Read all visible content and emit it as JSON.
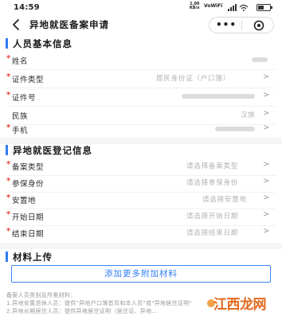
{
  "status_bar": {
    "time": "14:59",
    "net_speed": "1.00\nKB/s",
    "vowifi": "VoWiFi",
    "battery_level": 0.5
  },
  "header": {
    "title": "异地就医备案申请",
    "back_icon": "chevron-left-icon",
    "more_icon": "more-dots-icon",
    "close_icon": "target-close-icon"
  },
  "sections": {
    "basic": {
      "title": "人员基本信息"
    },
    "register": {
      "title": "异地就医登记信息"
    },
    "materials": {
      "title": "材料上传"
    }
  },
  "basic_rows": [
    {
      "label": "姓名",
      "value": "",
      "required": "*",
      "chevron": ""
    },
    {
      "label": "证件类型",
      "value": "居民身份证（户口簿）",
      "required": "*",
      "chevron": ">"
    },
    {
      "label": "证件号",
      "value": "",
      "required": "*",
      "chevron": ">"
    },
    {
      "label": "民族",
      "value": "汉族",
      "required": "",
      "chevron": ">"
    },
    {
      "label": "手机",
      "value": "",
      "required": "*",
      "chevron": ">"
    }
  ],
  "register_rows": [
    {
      "label": "备案类型",
      "value": "请选择备案类型",
      "required": "*",
      "chevron": ">"
    },
    {
      "label": "参保身份",
      "value": "请选择参保身份",
      "required": "*",
      "chevron": ">"
    },
    {
      "label": "安置地",
      "value": "请选择安置地",
      "required": "*",
      "chevron": ">"
    },
    {
      "label": "开始日期",
      "value": "请选择开始日期",
      "required": "*",
      "chevron": ">"
    },
    {
      "label": "结束日期",
      "value": "请选择结束日期",
      "required": "*",
      "chevron": ">"
    }
  ],
  "materials": {
    "add_button": "添加更多附加材料",
    "notes": [
      "备案人员类别及所需材料：",
      "1.异地安置退休人员：提供\"异地户口簿首页和本人页\"或\"异地居住证明\"",
      "2.异地长期居住人员：提供异地居住证明（居住证、异地…"
    ]
  },
  "watermark": {
    "text": "江西龙网"
  },
  "colors": {
    "accent": "#2f7cf0",
    "required": "#e8433a",
    "placeholder": "#b3b3b3",
    "watermark": "#e2681b"
  }
}
